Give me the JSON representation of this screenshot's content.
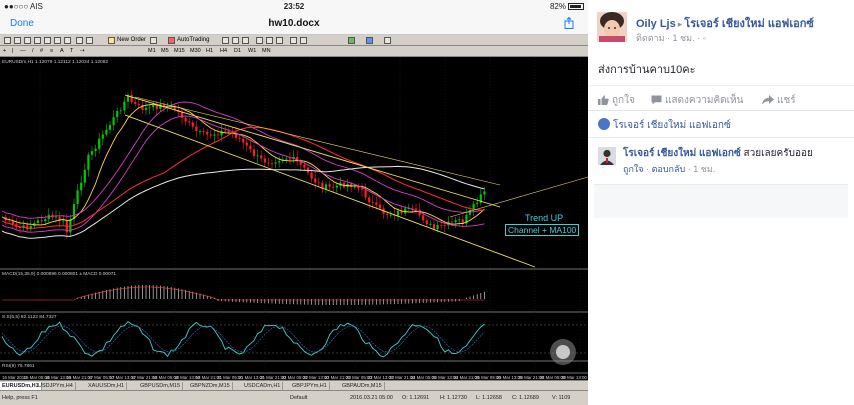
{
  "statusbar": {
    "carrier": "●●○○○ AIS",
    "time": "23:52",
    "battery": "82%"
  },
  "navbar": {
    "done": "Done",
    "title": "hw10.docx"
  },
  "toolbar": {
    "new_order": "New Order",
    "auto_trading": "AutoTrading",
    "timeframes": [
      "M1",
      "M5",
      "M15",
      "M30",
      "H1",
      "H4",
      "D1",
      "W1",
      "MN"
    ]
  },
  "chart": {
    "symbol_header": "EURUSDm,H1 1.12079 1.12112 1.12034 1.12082",
    "macd_label": "MACD(15,35,9) 0.000896 0.000801 ± MACD 0.00071",
    "stoch_label": "S.S(5,5) 82.1122 84.7327",
    "rsi_label": "RSI(9) 76.7861",
    "annotation_trend": "Trend UP",
    "annotation_channel": "Channel + MA100",
    "time_labels": [
      "16 Mar 2016",
      "16 Mar 05:00",
      "16 Mar 13:00",
      "16 Mar 21:00",
      "17 Mar 05:00",
      "17 Mar 13:00",
      "17 Mar 21:00",
      "18 Mar 05:00",
      "18 Mar 13:00",
      "18 Mar 21:00",
      "21 Mar 05:00",
      "21 Mar 13:00",
      "21 Mar 21:00",
      "22 Mar 05:00",
      "22 Mar 13:00",
      "22 Mar 21:00",
      "23 Mar 05:00",
      "23 Mar 13:00",
      "23 Mar 21:00",
      "24 Mar 05:00",
      "24 Mar 13:00",
      "24 Mar 21:00",
      "25 Mar 05:00",
      "25 Mar 13:00",
      "25 Mar 21:00",
      "28 Mar 05:00",
      "28 Mar 13:00"
    ]
  },
  "tabs": [
    "EURUSDm,H1",
    "USDJPYm,H4",
    "XAUUSDm,H1",
    "GBPUSDm,M15",
    "GBPNZDm,M15",
    "USDCADm,H1",
    "GBPJPYm,H1",
    "GBPAUDm,M15"
  ],
  "bottombar": {
    "help": "Help, press F1",
    "profile": "Default",
    "datetime": "2016.03.21 05:00",
    "open": "O: 1.12691",
    "high": "H: 1.12730",
    "low": "L: 1.12658",
    "close": "C: 1.12689",
    "volume": "V: 1109"
  },
  "fb": {
    "author": "Oily Ljs",
    "target_page": "โรเจอร์ เชียงใหม่ แอฟเอกซ์",
    "follow": "ติดตาม",
    "time": "1 ชม.",
    "post_text": "ส่งการบ้านคาบ10คะ",
    "like": "ถูกใจ",
    "comment": "แสดงความคิดเห็น",
    "share": "แชร์",
    "liked_by": "โรเจอร์ เชียงใหม่ แอฟเอกซ์",
    "comment_author": "โรเจอร์ เชียงใหม่ แอฟเอกซ์",
    "comment_text": "สวยเลยครับออย",
    "comment_like": "ถูกใจ",
    "comment_reply": "ตอบกลับ",
    "comment_time": "1 ชม."
  },
  "colors": {
    "fb_blue": "#365899",
    "ios_blue": "#1a7cf0",
    "candle_up": "#00c800",
    "candle_down": "#ff2020",
    "annotation": "#3fd1d9"
  }
}
